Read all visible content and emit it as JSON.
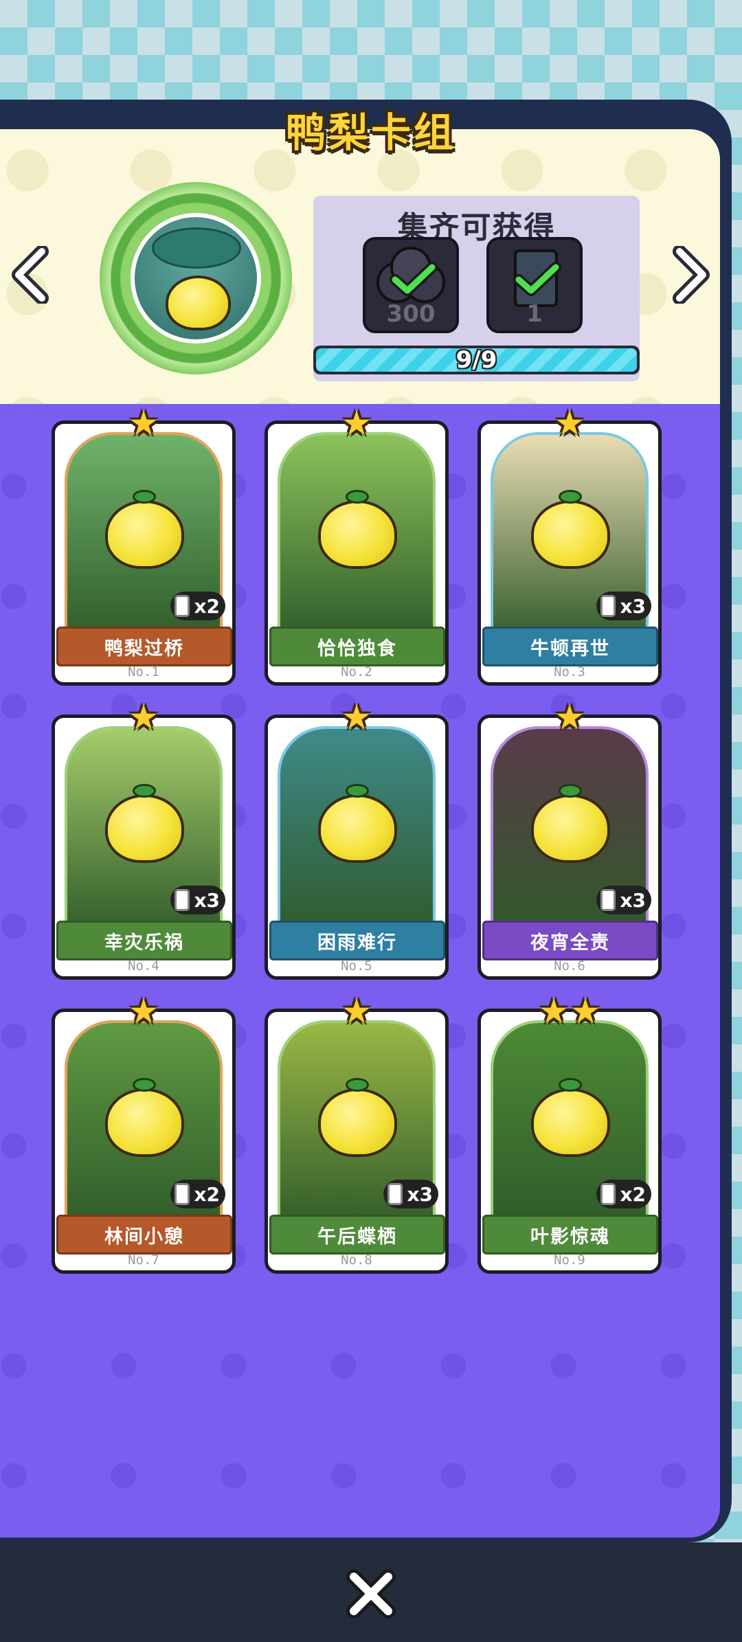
{
  "title": "鸭梨卡组",
  "reward": {
    "title": "集齐可获得",
    "items": [
      {
        "name": "coins",
        "count": "300",
        "icon": "coin-stack-icon"
      },
      {
        "name": "card-back",
        "count": "1",
        "icon": "card-back-icon"
      }
    ],
    "progress_text": "9/9",
    "progress_fraction": 1.0
  },
  "cards": [
    {
      "title": "鸭梨过桥",
      "no": "No.1",
      "dup": "x2",
      "stars": 1,
      "banner_color": "#b5592a",
      "bg": "#6fb36a",
      "frame": "#e0a35b"
    },
    {
      "title": "恰恰独食",
      "no": "No.2",
      "dup": "",
      "stars": 1,
      "banner_color": "#4f8a3a",
      "bg": "#8cc25a",
      "frame": "#9fd07a"
    },
    {
      "title": "牛顿再世",
      "no": "No.3",
      "dup": "x3",
      "stars": 1,
      "banner_color": "#2f7fa2",
      "bg": "#e9dcb3",
      "frame": "#7cc8e4"
    },
    {
      "title": "幸灾乐祸",
      "no": "No.4",
      "dup": "x3",
      "stars": 1,
      "banner_color": "#4f8a3a",
      "bg": "#a6cc6a",
      "frame": "#9fd07a"
    },
    {
      "title": "困雨难行",
      "no": "No.5",
      "dup": "",
      "stars": 1,
      "banner_color": "#2f7fa2",
      "bg": "#3f8a8a",
      "frame": "#7cc8e4"
    },
    {
      "title": "夜宵全责",
      "no": "No.6",
      "dup": "x3",
      "stars": 1,
      "banner_color": "#7a4bc4",
      "bg": "#5b3a4a",
      "frame": "#b18ae0"
    },
    {
      "title": "林间小憩",
      "no": "No.7",
      "dup": "x2",
      "stars": 1,
      "banner_color": "#b5592a",
      "bg": "#5f9a42",
      "frame": "#e0a35b"
    },
    {
      "title": "午后蝶栖",
      "no": "No.8",
      "dup": "x3",
      "stars": 1,
      "banner_color": "#4f8a3a",
      "bg": "#9ab845",
      "frame": "#9fd07a"
    },
    {
      "title": "叶影惊魂",
      "no": "No.9",
      "dup": "x2",
      "stars": 2,
      "banner_color": "#4f8a3a",
      "bg": "#4d8a35",
      "frame": "#9fd07a"
    }
  ]
}
